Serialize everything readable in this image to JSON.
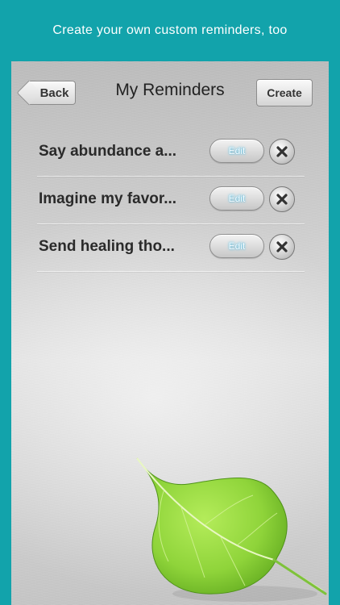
{
  "caption": "Create your own custom reminders, too",
  "navbar": {
    "title": "My Reminders",
    "back_label": "Back",
    "create_label": "Create"
  },
  "reminders": [
    {
      "label": "Say abundance a...",
      "edit_label": "Edit"
    },
    {
      "label": "Imagine my favor...",
      "edit_label": "Edit"
    },
    {
      "label": "Send healing tho...",
      "edit_label": "Edit"
    }
  ],
  "colors": {
    "background": "#12a3ab",
    "leaf": "#8fd43a",
    "edit_text_glow": "#4fc3e8"
  },
  "icons": {
    "delete": "close-circle-icon",
    "decoration": "leaf-icon"
  }
}
